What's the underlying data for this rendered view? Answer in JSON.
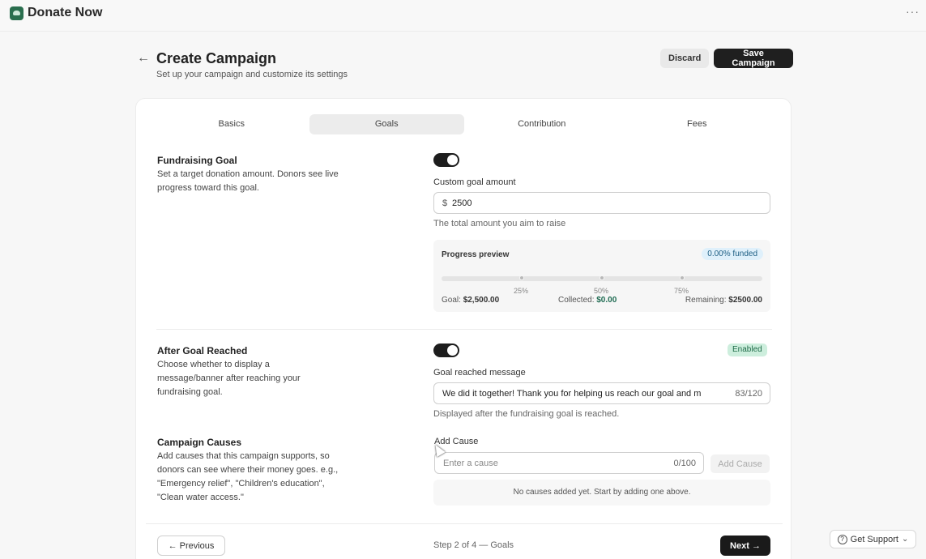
{
  "app": {
    "brand_name": "Donate Now",
    "more_label": "···"
  },
  "header": {
    "back_icon": "←",
    "title": "Create Campaign",
    "subtitle": "Set up your campaign and customize its settings",
    "discard_label": "Discard",
    "save_label": "Save Campaign"
  },
  "tabs": [
    {
      "label": "Basics",
      "active": false
    },
    {
      "label": "Goals",
      "active": true
    },
    {
      "label": "Contribution",
      "active": false
    },
    {
      "label": "Fees",
      "active": false
    }
  ],
  "fundraising": {
    "title": "Fundraising Goal",
    "description": "Set a target donation amount. Donors see live progress toward this goal.",
    "toggle_on": true,
    "amount_label": "Custom goal amount",
    "currency_symbol": "$",
    "amount_value": "2500",
    "amount_help": "The total amount you aim to raise",
    "preview": {
      "title": "Progress preview",
      "funded_badge": "0.00% funded",
      "progress_fraction": 0.0,
      "markers": [
        "25%",
        "50%",
        "75%"
      ],
      "goal_label": "Goal:",
      "goal_value": "$2,500.00",
      "collected_label": "Collected:",
      "collected_value": "$0.00",
      "remaining_label": "Remaining:",
      "remaining_value": "$2500.00"
    }
  },
  "after_goal": {
    "title": "After Goal Reached",
    "description": "Choose whether to display a message/banner after reaching your fundraising goal.",
    "toggle_on": true,
    "status_badge": "Enabled",
    "message_label": "Goal reached message",
    "message_value": "We did it together! Thank you for helping us reach our goal and m",
    "message_counter": "83/120",
    "message_help": "Displayed after the fundraising goal is reached."
  },
  "causes": {
    "title": "Campaign Causes",
    "description": "Add causes that this campaign supports, so donors can see where their money goes. e.g., \"Emergency relief\", \"Children's education\", \"Clean water access.\"",
    "add_label": "Add Cause",
    "input_placeholder": "Enter a cause",
    "input_counter": "0/100",
    "add_button": "Add Cause",
    "empty_text": "No causes added yet. Start by adding one above."
  },
  "footer": {
    "previous_label": "← Previous",
    "step_text": "Step 2 of 4 — Goals",
    "next_label": "Next →"
  },
  "support": {
    "label": "Get Support",
    "chevron": "⌄"
  },
  "colors": {
    "accent": "#1f1f1f",
    "success": "#2a7a55",
    "info_badge": "#dff0fb"
  }
}
